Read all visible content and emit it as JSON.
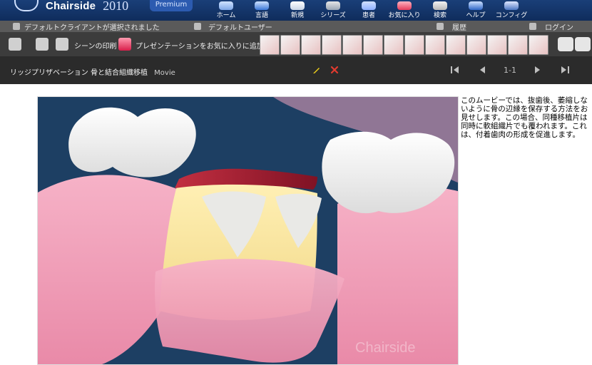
{
  "app": {
    "brand": "Chairside",
    "year": "2010",
    "edition": "Premium"
  },
  "nav": {
    "items": [
      {
        "label": "ホーム",
        "icon": "home-icon"
      },
      {
        "label": "言語",
        "icon": "language-icon"
      },
      {
        "label": "新規",
        "icon": "new-icon"
      },
      {
        "label": "シリーズ",
        "icon": "series-icon"
      },
      {
        "label": "患者",
        "icon": "patient-icon"
      },
      {
        "label": "お気に入り",
        "icon": "favorites-icon"
      },
      {
        "label": "検索",
        "icon": "search-icon"
      },
      {
        "label": "ヘルプ",
        "icon": "help-icon"
      },
      {
        "label": "コンフィグ",
        "icon": "config-icon"
      }
    ]
  },
  "status": {
    "client": "デフォルトクライアントが選択されました",
    "user": "デフォルトユーザー",
    "history": "履歴",
    "login": "ログイン"
  },
  "toolbar": {
    "print_scene": "シーンの印刷",
    "add_to_favorites": "プレゼンテーションをお気に入りに追加",
    "thumbnail_count": 15
  },
  "title": {
    "breadcrumb": "リッジプリザベーション 骨と結合組織移植",
    "type": "Movie",
    "page": "1-1"
  },
  "description": "このムービーでは、抜歯後、萎縮しないように骨の辺縁を保存する方法をお見せします。この場合、同種移植片は同時に軟組織片でも覆われます。これは、付着歯肉の形成を促進します。",
  "watermark": "Chairside",
  "colors": {
    "brand_blue": "#173a72",
    "toolbar_gray": "#3c3c3c",
    "title_bar": "#2b2b2b",
    "edit_yellow": "#f2d21a",
    "delete_red": "#e33b2f",
    "scene_bg": "#1d3f63"
  }
}
